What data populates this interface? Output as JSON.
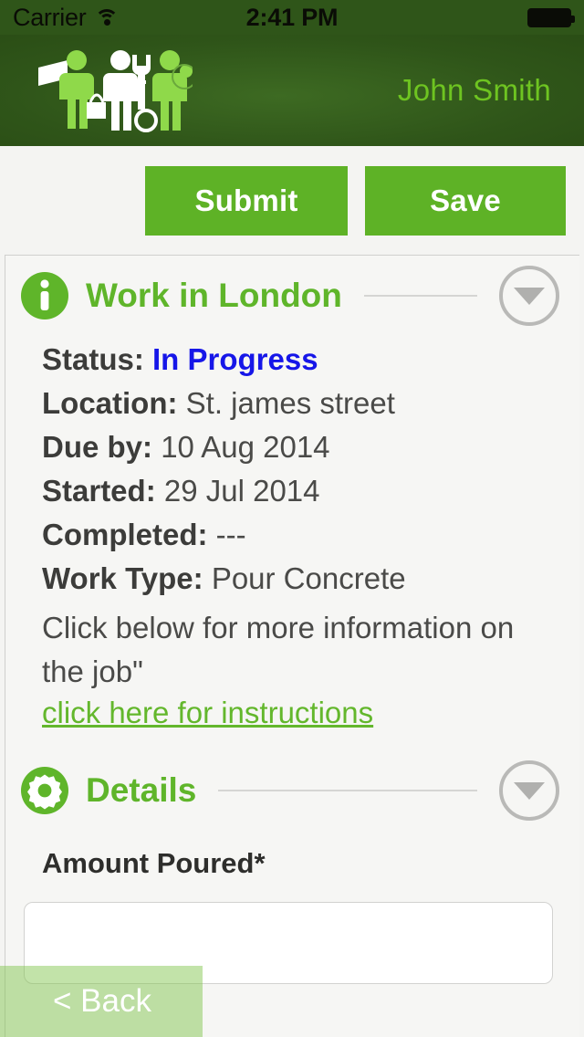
{
  "statusbar": {
    "carrier": "Carrier",
    "wifi_icon": "wifi-icon",
    "time": "2:41 PM",
    "battery_icon": "battery-full-icon"
  },
  "header": {
    "logo_icon": "workers-logo-icon",
    "username": "John Smith",
    "background_color": "#2f5519",
    "username_color": "#6ec421"
  },
  "toolbar": {
    "submit_label": "Submit",
    "save_label": "Save",
    "button_color": "#5eb226"
  },
  "job_section": {
    "icon": "info-circle-icon",
    "title": "Work in London",
    "collapse_icon": "chevron-down-icon",
    "fields": [
      {
        "label": "Status:",
        "value": "In Progress",
        "highlight": true
      },
      {
        "label": "Location:",
        "value": "St. james street",
        "highlight": false
      },
      {
        "label": "Due by:",
        "value": "10 Aug 2014",
        "highlight": false
      },
      {
        "label": "Started:",
        "value": "29 Jul 2014",
        "highlight": false
      },
      {
        "label": "Completed:",
        "value": "---",
        "highlight": false
      },
      {
        "label": "Work Type:",
        "value": "Pour Concrete",
        "highlight": false
      }
    ],
    "description": "Click below for more information on the job\"",
    "link_label": "click here for instructions",
    "status_color": "#1616e8",
    "link_color": "#63b72c"
  },
  "details_section": {
    "icon": "gear-icon",
    "title": "Details",
    "collapse_icon": "chevron-down-icon",
    "amount_label": "Amount Poured*",
    "amount_value": "",
    "amount_placeholder": ""
  },
  "footer": {
    "back_label": "< Back"
  }
}
